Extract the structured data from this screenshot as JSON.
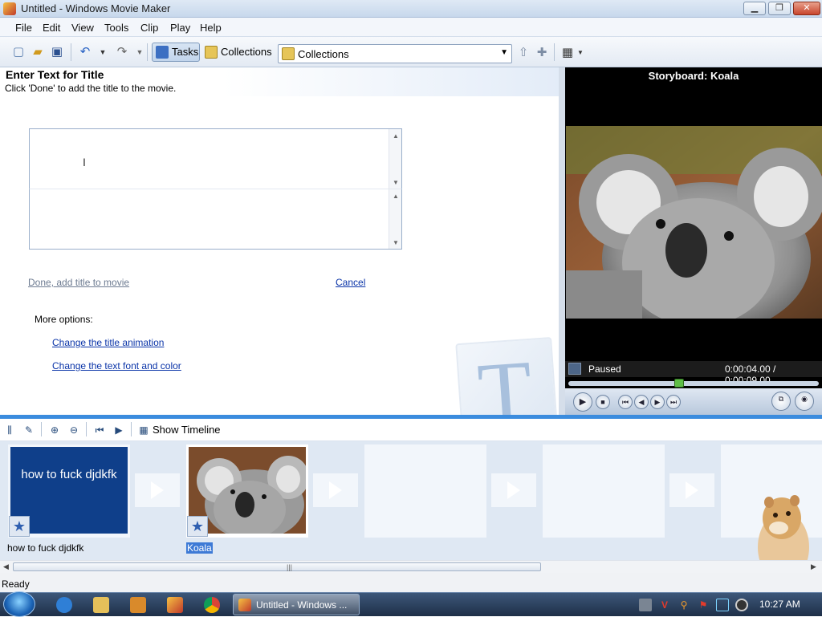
{
  "window": {
    "title": "Untitled - Windows Movie Maker"
  },
  "menu": [
    "File",
    "Edit",
    "View",
    "Tools",
    "Clip",
    "Play",
    "Help"
  ],
  "toolbar": {
    "tasks_label": "Tasks",
    "collections_label": "Collections",
    "collections_dropdown_value": "Collections"
  },
  "task_pane": {
    "title": "Enter Text for Title",
    "subtitle": "Click 'Done' to add the title to the movie.",
    "title_text_value": "",
    "subtitle_text_value": "",
    "done_link": "Done, add title to movie",
    "cancel_link": "Cancel",
    "more_options_label": "More options:",
    "options": [
      "Change the title animation",
      "Change the text font and color"
    ],
    "watermark_letter": "T"
  },
  "preview": {
    "heading": "Storyboard: Koala",
    "status": "Paused",
    "time": "0:00:04.00 / 0:00:09.00",
    "progress": 0.44
  },
  "storyboard": {
    "show_timeline_label": "Show Timeline",
    "clips": [
      {
        "thumb_text": "how to fuck djdkfk",
        "label": "how to fuck djdkfk",
        "selected": false
      },
      {
        "thumb_text": "",
        "label": "Koala",
        "selected": true
      }
    ]
  },
  "status_bar": {
    "text": "Ready"
  },
  "taskbar": {
    "active_task": "Untitled - Windows ...",
    "clock": "10:27 AM"
  },
  "colors": {
    "accent": "#3b8cde",
    "link": "#0a34a8",
    "title_clip_bg": "#0f3f8a"
  }
}
